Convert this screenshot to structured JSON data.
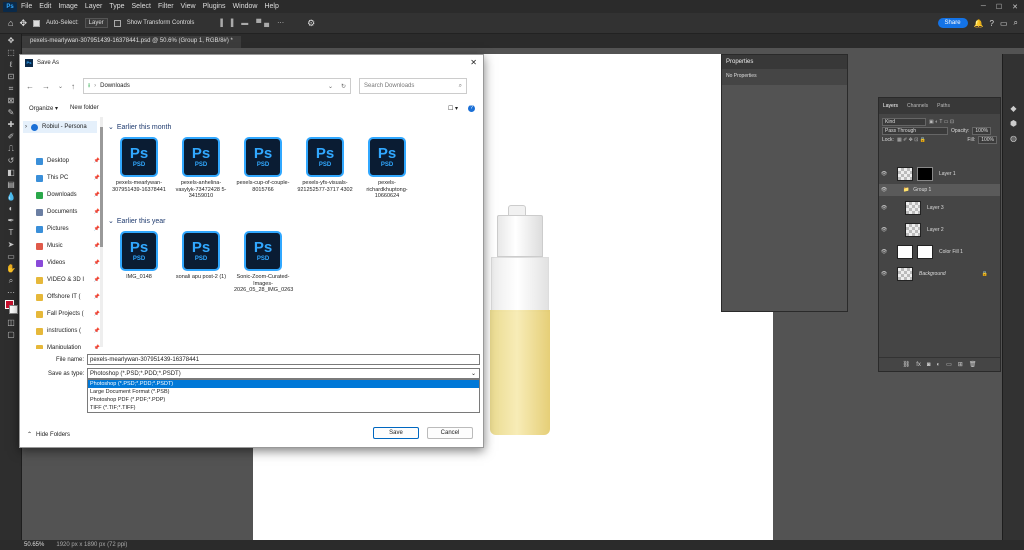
{
  "app": {
    "logo": "Ps",
    "menu": [
      "File",
      "Edit",
      "Image",
      "Layer",
      "Type",
      "Select",
      "Filter",
      "View",
      "Plugins",
      "Window",
      "Help"
    ]
  },
  "options": {
    "auto_select": "Auto-Select:",
    "layer": "Layer",
    "transform": "Show Transform Controls",
    "share": "Share"
  },
  "document": {
    "tab": "pexels-mearlywan-3079514​39-16378441.psd @ 50.6% (Group 1, RGB/8#) *"
  },
  "status": {
    "zoom": "50.65%",
    "info": "1920 px x 1890 px (72 ppi)"
  },
  "properties": {
    "title": "Properties",
    "body": "No Properties"
  },
  "layers_panel": {
    "tabs": [
      "Layers",
      "Channels",
      "Paths"
    ],
    "kind": "Kind",
    "blend": "Pass Through",
    "opacity_label": "Opacity:",
    "opacity": "100%",
    "lock_label": "Lock:",
    "fill_label": "Fill:",
    "fill": "100%",
    "layers": [
      "Layer 1",
      "Group 1",
      "Layer 3",
      "Layer 2",
      "Color Fill 1",
      "Background"
    ]
  },
  "dialog": {
    "title": "Save As",
    "address": "Downloads",
    "search_placeholder": "Search Downloads",
    "organize": "Organize",
    "new_folder": "New folder",
    "nav_top": "Robiul - Persona",
    "nav_items": [
      {
        "label": "Desktop",
        "color": "#3a8fd9"
      },
      {
        "label": "This PC",
        "color": "#3a8fd9"
      },
      {
        "label": "Downloads",
        "color": "#2aa84a"
      },
      {
        "label": "Documents",
        "color": "#6b7fa3"
      },
      {
        "label": "Pictures",
        "color": "#3a8fd9"
      },
      {
        "label": "Music",
        "color": "#e05a4a"
      },
      {
        "label": "Videos",
        "color": "#8a4ad9"
      },
      {
        "label": "VIDEO & 3D I",
        "color": "#e6b83a"
      },
      {
        "label": "Offshore IT (",
        "color": "#e6b83a"
      },
      {
        "label": "Fall Projects (",
        "color": "#e6b83a"
      },
      {
        "label": "instructions (",
        "color": "#e6b83a"
      },
      {
        "label": "Manipulation",
        "color": "#e6b83a"
      }
    ],
    "groups": [
      "Earlier this month",
      "Earlier this year"
    ],
    "files_month": [
      {
        "name": "pexels-mearlywan-307951439-16378441"
      },
      {
        "name": "pexels-anhelina-vasylyk-73472428 5-34159010"
      },
      {
        "name": "pexels-cup-of-couple-8015766"
      },
      {
        "name": "pexels-yfs-visuals-921252577-3717 4302"
      },
      {
        "name": "pexels-richardkhuptong-10660624"
      }
    ],
    "files_year": [
      {
        "name": "IMG_0148"
      },
      {
        "name": "sonali apu post-2 (1)"
      },
      {
        "name": "Sonic-Zoom-Curated-Images-2026_05_28_IMG_0263"
      }
    ],
    "psd_label": "PSD",
    "ps_label": "Ps",
    "file_name_label": "File name:",
    "file_name": "pexels-mearlywan-307951439-16378441",
    "save_type_label": "Save as type:",
    "save_type": "Photoshop (*.PSD;*.PDD;*.PSDT)",
    "types": [
      "Photoshop (*.PSD;*.PDD;*.PSDT)",
      "Large Document Format (*.PSB)",
      "Photoshop PDF (*.PDF;*.PDP)",
      "TIFF (*.TIF;*.TIFF)"
    ],
    "hide_folders": "Hide Folders",
    "save": "Save",
    "cancel": "Cancel"
  },
  "colors": {
    "ps_blue": "#31a8ff",
    "share_blue": "#1473e6",
    "selection": "#0078d7"
  }
}
